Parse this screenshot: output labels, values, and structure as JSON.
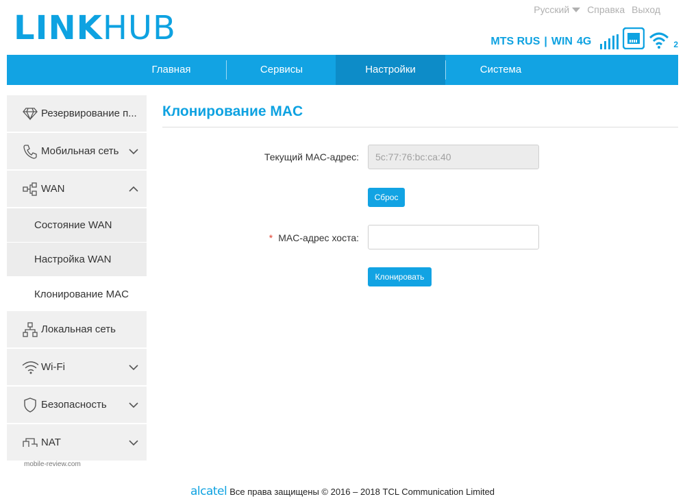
{
  "header": {
    "logo_bold": "LINK",
    "logo_light": "HUB",
    "language": "Русский",
    "help": "Справка",
    "logout": "Выход",
    "operator": "MTS RUS",
    "network_type": "WIN",
    "generation": "4G",
    "wifi_clients": "2"
  },
  "nav": {
    "items": [
      {
        "label": "Главная"
      },
      {
        "label": "Сервисы"
      },
      {
        "label": "Настройки"
      },
      {
        "label": "Система"
      }
    ],
    "active_index": 2
  },
  "sidebar": {
    "items": [
      {
        "label": "Резервирование п...",
        "icon": "diamond-icon"
      },
      {
        "label": "Мобильная сеть",
        "icon": "phone-icon",
        "expandable": true
      },
      {
        "label": "WAN",
        "icon": "network-icon",
        "expanded": true
      },
      {
        "label": "Локальная сеть",
        "icon": "lan-icon"
      },
      {
        "label": "Wi-Fi",
        "icon": "wifi-icon",
        "expandable": true
      },
      {
        "label": "Безопасность",
        "icon": "shield-icon",
        "expandable": true
      },
      {
        "label": "NAT",
        "icon": "nat-icon",
        "expandable": true
      }
    ],
    "wan_subitems": [
      {
        "label": "Состояние WAN"
      },
      {
        "label": "Настройка WAN"
      },
      {
        "label": "Клонирование MAC",
        "active": true
      }
    ]
  },
  "main": {
    "title": "Клонирование MAC",
    "current_mac_label": "Текущий MAC-адрес:",
    "current_mac_value": "5c:77:76:bc:ca:40",
    "reset_button": "Сброс",
    "host_mac_label": "MAC-адрес хоста:",
    "host_mac_required_mark": "*",
    "host_mac_value": "",
    "clone_button": "Клонировать"
  },
  "footer": {
    "brand": "alcatel",
    "text": "Все права защищены © 2016 – 2018 TCL Communication Limited"
  },
  "watermark": "mobile-review.com",
  "colors": {
    "accent": "#0ea2e1",
    "nav_bg": "#12a3e3",
    "nav_active": "#0d8cc8",
    "required": "#e0402f"
  }
}
